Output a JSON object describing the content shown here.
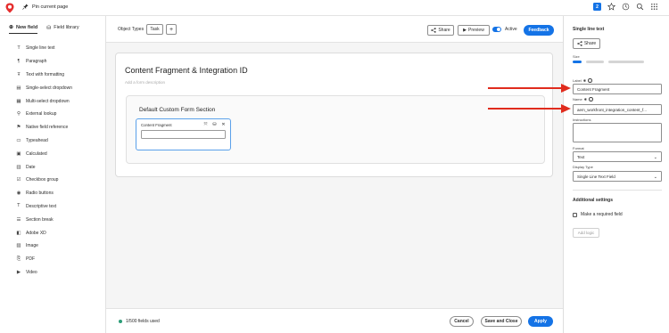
{
  "topbar": {
    "pin_label": "Pin current page",
    "badge_count": "2"
  },
  "sidebar": {
    "tabs": [
      {
        "label": "New field",
        "active": true
      },
      {
        "label": "Field library",
        "active": false
      }
    ],
    "items": [
      {
        "label": "Single line text",
        "icon": "single-line-text-icon"
      },
      {
        "label": "Paragraph",
        "icon": "paragraph-icon"
      },
      {
        "label": "Text with formatting",
        "icon": "text-formatting-icon"
      },
      {
        "label": "Single-select dropdown",
        "icon": "single-select-icon"
      },
      {
        "label": "Multi-select dropdown",
        "icon": "multi-select-icon"
      },
      {
        "label": "External lookup",
        "icon": "external-lookup-icon"
      },
      {
        "label": "Native field reference",
        "icon": "native-field-icon"
      },
      {
        "label": "Typeahead",
        "icon": "typeahead-icon"
      },
      {
        "label": "Calculated",
        "icon": "calculated-icon"
      },
      {
        "label": "Date",
        "icon": "date-icon"
      },
      {
        "label": "Checkbox group",
        "icon": "checkbox-group-icon"
      },
      {
        "label": "Radio buttons",
        "icon": "radio-buttons-icon"
      },
      {
        "label": "Descriptive text",
        "icon": "descriptive-text-icon"
      },
      {
        "label": "Section break",
        "icon": "section-break-icon"
      },
      {
        "label": "Adobe XD",
        "icon": "adobe-xd-icon"
      },
      {
        "label": "Image",
        "icon": "image-icon"
      },
      {
        "label": "PDF",
        "icon": "pdf-icon"
      },
      {
        "label": "Video",
        "icon": "video-icon"
      }
    ]
  },
  "toolbar": {
    "object_types_label": "Object Types",
    "task_label": "Task",
    "share_label": "Share",
    "preview_label": "Preview",
    "active_label": "Active",
    "feedback_label": "Feedback"
  },
  "form": {
    "title": "Content Fragment & Integration ID",
    "description_placeholder": "Add a form description",
    "section_title": "Default Custom Form Section",
    "field_label": "Content Fragment"
  },
  "footer": {
    "fields_used": "1/500 fields used",
    "cancel_label": "Cancel",
    "save_close_label": "Save and Close",
    "apply_label": "Apply"
  },
  "right_panel": {
    "title": "Single line text",
    "share_label": "Share",
    "size_label": "Size",
    "size_selected_index": 0,
    "label_label": "Label",
    "label_value": "Content Fragment",
    "name_label": "Name",
    "name_value": "aem_workfront_integration_content_f...",
    "instructions_label": "Instructions",
    "format_label": "Format",
    "format_value": "Text",
    "display_type_label": "Display Type",
    "display_type_value": "Single Line Text Field",
    "additional_settings_label": "Additional settings",
    "required_label": "Make a required field",
    "add_logic_label": "Add logic"
  },
  "colors": {
    "accent": "#1473e6",
    "arrow": "#e02b1d",
    "status_green": "#2d9d78"
  }
}
